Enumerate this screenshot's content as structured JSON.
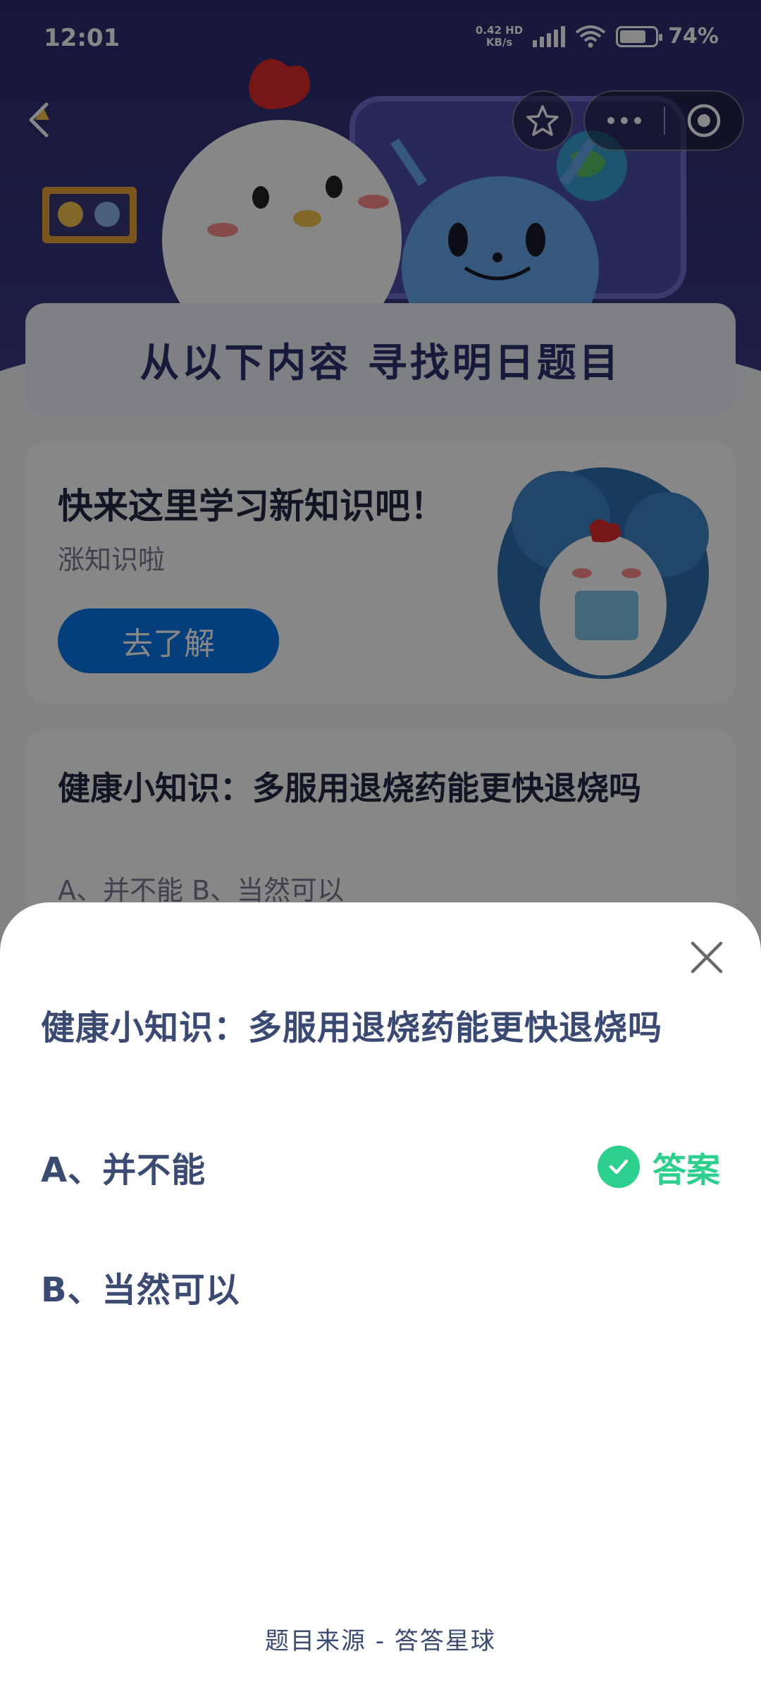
{
  "status_bar": {
    "time": "12:01",
    "net_speed_value": "0.42",
    "net_speed_unit": "KB/s",
    "network_type": "HD",
    "battery_percent": "74%",
    "battery_level": 0.74
  },
  "background": {
    "banner_title": "从以下内容  寻找明日题目",
    "learn_card": {
      "title": "快来这里学习新知识吧！",
      "subtitle": "涨知识啦",
      "button_label": "去了解"
    },
    "quiz_card": {
      "question": "健康小知识：多服用退烧药能更快退烧吗",
      "options_line": "A、并不能    B、当然可以"
    }
  },
  "sheet": {
    "question": "健康小知识：多服用退烧药能更快退烧吗",
    "options": [
      {
        "label": "A、并不能",
        "is_answer": true
      },
      {
        "label": "B、当然可以",
        "is_answer": false
      }
    ],
    "answer_label": "答案",
    "source": "题目来源 - 答答星球"
  },
  "colors": {
    "accent_blue": "#0a78e8",
    "answer_green": "#2dcf8c",
    "text_navy": "#3b4a72",
    "hero_purple": "#2c2d6e"
  },
  "icons": [
    "back-arrow-icon",
    "star-icon",
    "more-dots-icon",
    "target-close-icon",
    "close-x-icon",
    "check-circle-icon"
  ]
}
